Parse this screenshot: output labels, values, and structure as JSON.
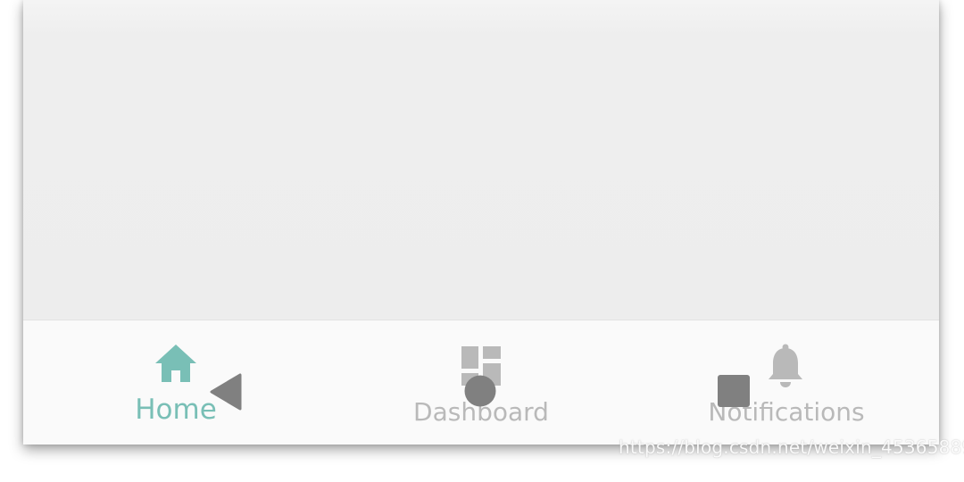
{
  "bottom_nav": {
    "items": [
      {
        "label": "Home",
        "icon": "home-icon",
        "selected": true
      },
      {
        "label": "Dashboard",
        "icon": "dashboard-icon",
        "selected": false
      },
      {
        "label": "Notifications",
        "icon": "bell-icon",
        "selected": false
      }
    ]
  },
  "system_nav": {
    "icons": [
      "back-triangle-icon",
      "home-circle-icon",
      "recents-square-icon"
    ]
  },
  "watermark": "https://blog.csdn.net/weixin_45365889",
  "colors": {
    "accent": "#79bfb6",
    "inactive": "#b9b9b9",
    "content_bg": "#eeeeee",
    "nav_bg": "#fafafa",
    "system_button": "#808080"
  }
}
